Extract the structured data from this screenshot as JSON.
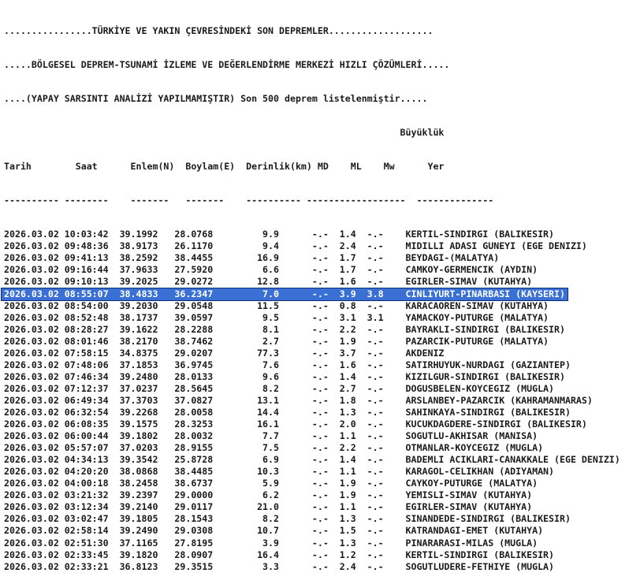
{
  "header": {
    "line1": "................TÜRKİYE VE YAKIN ÇEVRESİNDEKİ SON DEPREMLER...................",
    "line2": ".....BÖLGESEL DEPREM-TSUNAMİ İZLEME VE DEĞERLENDİRME MERKEZİ HIZLI ÇÖZÜMLERİ.....",
    "line3": "....(YAPAY SARSINTI ANALİZİ YAPILMAMIŞTIR) Son 500 deprem listelenmiştir....."
  },
  "columns": {
    "buyukluk": "Büyüklük",
    "tarih": "Tarih",
    "saat": "Saat",
    "enlem": "Enlem(N)",
    "boylam": "Boylam(E)",
    "derinlik": "Derinlik(km)",
    "md": "MD",
    "ml": "ML",
    "mw": "Mw",
    "yer": "Yer"
  },
  "selected_index": 5,
  "rows": [
    [
      "2026.03.02",
      "10:03:42",
      "39.1992",
      "28.0768",
      "9.9",
      "-.-",
      "1.4",
      "-.-",
      "KERTIL-SINDIRGI (BALIKESIR)"
    ],
    [
      "2026.03.02",
      "09:48:36",
      "38.9173",
      "26.1170",
      "9.4",
      "-.-",
      "2.4",
      "-.-",
      "MIDILLI ADASI GUNEYI (EGE DENIZI)"
    ],
    [
      "2026.03.02",
      "09:41:13",
      "38.2592",
      "38.4455",
      "16.9",
      "-.-",
      "1.7",
      "-.-",
      "BEYDAGI-(MALATYA)"
    ],
    [
      "2026.03.02",
      "09:16:44",
      "37.9633",
      "27.5920",
      "6.6",
      "-.-",
      "1.7",
      "-.-",
      "CAMKOY-GERMENCIK (AYDIN)"
    ],
    [
      "2026.03.02",
      "09:10:13",
      "39.2025",
      "29.0272",
      "12.8",
      "-.-",
      "1.6",
      "-.-",
      "EGIRLER-SIMAV (KUTAHYA)"
    ],
    [
      "2026.03.02",
      "08:55:07",
      "38.4833",
      "36.2347",
      "7.0",
      "-.-",
      "3.9",
      "3.8",
      "CINLIYURT-PINARBASI (KAYSERI)"
    ],
    [
      "2026.03.02",
      "08:54:00",
      "39.2030",
      "29.0548",
      "11.5",
      "-.-",
      "0.8",
      "-.-",
      "KARACAOREN-SIMAV (KUTAHYA)"
    ],
    [
      "2026.03.02",
      "08:52:48",
      "38.1737",
      "39.0597",
      "9.5",
      "-.-",
      "3.1",
      "3.1",
      "YAMACKOY-PUTURGE (MALATYA)"
    ],
    [
      "2026.03.02",
      "08:28:27",
      "39.1622",
      "28.2288",
      "8.1",
      "-.-",
      "2.2",
      "-.-",
      "BAYRAKLI-SINDIRGI (BALIKESIR)"
    ],
    [
      "2026.03.02",
      "08:01:46",
      "38.2170",
      "38.7462",
      "2.7",
      "-.-",
      "1.9",
      "-.-",
      "PAZARCIK-PUTURGE (MALATYA)"
    ],
    [
      "2026.03.02",
      "07:58:15",
      "34.8375",
      "29.0207",
      "77.3",
      "-.-",
      "3.7",
      "-.-",
      "AKDENIZ"
    ],
    [
      "2026.03.02",
      "07:48:06",
      "37.1853",
      "36.9745",
      "7.6",
      "-.-",
      "1.6",
      "-.-",
      "SATIRHUYUK-NURDAGI (GAZIANTEP)"
    ],
    [
      "2026.03.02",
      "07:46:34",
      "39.2480",
      "28.0133",
      "9.6",
      "-.-",
      "1.4",
      "-.-",
      "KIZILGUR-SINDIRGI (BALIKESIR)"
    ],
    [
      "2026.03.02",
      "07:12:37",
      "37.0237",
      "28.5645",
      "8.2",
      "-.-",
      "2.7",
      "-.-",
      "DOGUSBELEN-KOYCEGIZ (MUGLA)"
    ],
    [
      "2026.03.02",
      "06:49:34",
      "37.3703",
      "37.0827",
      "13.1",
      "-.-",
      "1.8",
      "-.-",
      "ARSLANBEY-PAZARCIK (KAHRAMANMARAS)"
    ],
    [
      "2026.03.02",
      "06:32:54",
      "39.2268",
      "28.0058",
      "14.4",
      "-.-",
      "1.3",
      "-.-",
      "SAHINKAYA-SINDIRGI (BALIKESIR)"
    ],
    [
      "2026.03.02",
      "06:08:35",
      "39.1575",
      "28.3253",
      "16.1",
      "-.-",
      "2.0",
      "-.-",
      "KUCUKDAGDERE-SINDIRGI (BALIKESIR)"
    ],
    [
      "2026.03.02",
      "06:00:44",
      "39.1802",
      "28.0032",
      "7.7",
      "-.-",
      "1.1",
      "-.-",
      "SOGUTLU-AKHISAR (MANISA)"
    ],
    [
      "2026.03.02",
      "05:57:07",
      "37.0203",
      "28.9155",
      "7.5",
      "-.-",
      "2.2",
      "-.-",
      "OTMANLAR-KOYCEGIZ (MUGLA)"
    ],
    [
      "2026.03.02",
      "04:34:13",
      "39.3542",
      "25.8728",
      "6.9",
      "-.-",
      "1.4",
      "-.-",
      "BADEMLI ACIKLARI-CANAKKALE (EGE DENIZI)"
    ],
    [
      "2026.03.02",
      "04:20:20",
      "38.0868",
      "38.4485",
      "10.3",
      "-.-",
      "1.1",
      "-.-",
      "KARAGOL-CELIKHAN (ADIYAMAN)"
    ],
    [
      "2026.03.02",
      "04:00:18",
      "38.2458",
      "38.6737",
      "5.9",
      "-.-",
      "1.9",
      "-.-",
      "CAYKOY-PUTURGE (MALATYA)"
    ],
    [
      "2026.03.02",
      "03:21:32",
      "39.2397",
      "29.0000",
      "6.2",
      "-.-",
      "1.9",
      "-.-",
      "YEMISLI-SIMAV (KUTAHYA)"
    ],
    [
      "2026.03.02",
      "03:12:34",
      "39.2140",
      "29.0117",
      "21.0",
      "-.-",
      "1.1",
      "-.-",
      "EGIRLER-SIMAV (KUTAHYA)"
    ],
    [
      "2026.03.02",
      "03:02:47",
      "39.1805",
      "28.1543",
      "8.2",
      "-.-",
      "1.3",
      "-.-",
      "SINANDEDE-SINDIRGI (BALIKESIR)"
    ],
    [
      "2026.03.02",
      "02:58:14",
      "39.2490",
      "29.0308",
      "10.7",
      "-.-",
      "1.5",
      "-.-",
      "KATRANDAGI-EMET (KUTAHYA)"
    ],
    [
      "2026.03.02",
      "02:51:30",
      "37.1165",
      "27.8195",
      "3.9",
      "-.-",
      "1.3",
      "-.-",
      "PINARARASI-MILAS (MUGLA)"
    ],
    [
      "2026.03.02",
      "02:33:45",
      "39.1820",
      "28.0907",
      "16.4",
      "-.-",
      "1.2",
      "-.-",
      "KERTIL-SINDIRGI (BALIKESIR)"
    ],
    [
      "2026.03.02",
      "02:33:21",
      "36.8123",
      "29.3515",
      "3.3",
      "-.-",
      "2.4",
      "-.-",
      "SOGUTLUDERE-FETHIYE (MUGLA)"
    ]
  ]
}
